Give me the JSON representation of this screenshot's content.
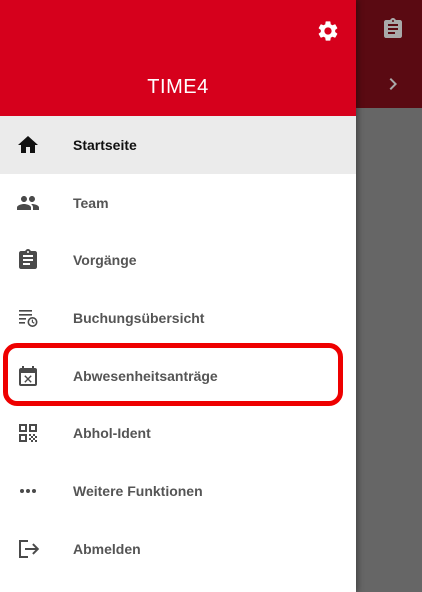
{
  "app": {
    "title": "TIME4"
  },
  "colors": {
    "brand": "#d6001c",
    "highlight": "#ee0000",
    "overlay": "#666666"
  },
  "header": {
    "settings_icon": "gear-icon"
  },
  "background": {
    "icons": [
      "clipboard-icon",
      "chevron-right-icon"
    ]
  },
  "menu": {
    "items": [
      {
        "label": "Startseite",
        "icon": "home-icon",
        "active": true
      },
      {
        "label": "Team",
        "icon": "people-icon"
      },
      {
        "label": "Vorgänge",
        "icon": "clipboard-icon"
      },
      {
        "label": "Buchungsübersicht",
        "icon": "list-clock-icon"
      },
      {
        "label": "Abwesenheitsanträge",
        "icon": "calendar-cancel-icon",
        "highlighted": true
      },
      {
        "label": "Abhol-Ident",
        "icon": "qr-code-icon"
      },
      {
        "label": "Weitere Funktionen",
        "icon": "more-horizontal-icon"
      },
      {
        "label": "Abmelden",
        "icon": "logout-icon"
      }
    ]
  }
}
